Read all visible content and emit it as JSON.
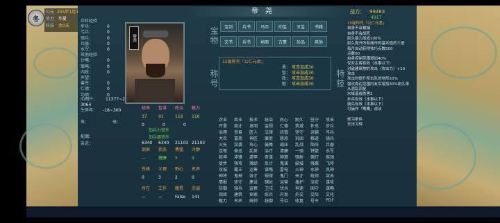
{
  "header": {
    "era_label": "公元",
    "date": "255年1月1",
    "faction_label": "势力",
    "faction_value": "华夏",
    "tech_label": "科技",
    "tech_value": "余0天",
    "season_char": "冬",
    "title": "帝　尧",
    "power_label": "战力：",
    "power_value": "99483",
    "power_sub": "4917"
  },
  "left_stats": [
    {
      "label": "兵科经验",
      "value": ""
    },
    {
      "label": "步兵：",
      "value": "0"
    },
    {
      "label": "弓兵：",
      "value": "0"
    },
    {
      "label": "骑兵：",
      "value": "0"
    },
    {
      "label": "兵器：",
      "value": "0"
    },
    {
      "label": "水军：",
      "value": "0"
    },
    {
      "label": "其他经验",
      "value": ""
    },
    {
      "label": "计略：",
      "value": "0"
    },
    {
      "label": "策略：",
      "value": "0"
    },
    {
      "label": "内政：",
      "value": "0"
    },
    {
      "label": "声望：",
      "value": ""
    },
    {
      "label": "兽性：",
      "value": "0"
    },
    {
      "label": "仁德：",
      "value": "0"
    },
    {
      "label": "功绩：",
      "value": "0"
    }
  ],
  "portrait_name": "帝尧",
  "id_label": "ID图片：",
  "id_value": "11377~2",
  "id_num": "3064",
  "birth_label": "生卒年：",
  "birth_value": "-18~300",
  "lifespan_label": "寿：",
  "mother_label": "母：",
  "spouse_label": "配偶：",
  "child_label": "亲近：",
  "ability_headers": [
    "统率",
    "智谋",
    "政治",
    "魅力"
  ],
  "ability_values": [
    "37",
    "91",
    "116",
    "116"
  ],
  "attrs_row2": [
    "0",
    "0",
    "0"
  ],
  "bonus1": "加兵力锁外",
  "bonus2": "加兵器锁外",
  "nums_row": [
    "6340",
    "6340",
    "21103",
    "21103"
  ],
  "status_headers": [
    "部屏",
    "状态",
    "勇猛",
    "冷静"
  ],
  "status_values": [
    "—",
    "健康",
    "5",
    "9"
  ],
  "traits_headers": [
    "性格",
    "义理",
    "野心",
    "名声"
  ],
  "traits_values": [
    "0",
    "3",
    "2",
    "0"
  ],
  "work_headers": [
    "所在",
    "工作",
    "籍贯",
    "忠诚"
  ],
  "work_values": [
    "—",
    "—",
    "False",
    "141"
  ],
  "sections": {
    "treasure": "宝物",
    "title": "称号",
    "special": "特技"
  },
  "treasure_slots": [
    "宝剑",
    "兵书",
    "马匹",
    "印玺",
    "玉玺",
    "书籍",
    "文书",
    "兵书",
    "地图",
    "古董",
    "珍品",
    "其他"
  ],
  "title_box_label": "15级称号「公仁元君」",
  "title_rows": [
    {
      "k": "勇：",
      "v": "攻击加成30"
    },
    {
      "k": "智：",
      "v": "攻击加成30"
    },
    {
      "k": "政：",
      "v": "攻击加成30"
    },
    {
      "k": "魅：",
      "v": "攻击加成30"
    }
  ],
  "skill_grid": [
    [
      "农业",
      "商业",
      "技术",
      "统治",
      "民心",
      "耐久",
      "驻守",
      "攻击"
    ],
    [
      "开垦",
      "商才",
      "发明",
      "监视",
      "仁德",
      "筑城",
      "补充",
      "步兵"
    ],
    [
      "治理",
      "贸易",
      "匠人",
      "法律",
      "抚恤",
      "坚守",
      "运输",
      "弓兵"
    ],
    [
      "大农",
      "富商",
      "神匠",
      "廉吏",
      "慈悲",
      "巩固",
      "粮道",
      "骑兵"
    ],
    [
      "火矢",
      "突袭",
      "攻心",
      "鼓舞",
      "威压",
      "乱战",
      "陷阵",
      "兵器"
    ],
    [
      "连弩",
      "奋迅",
      "乱射",
      "治疗",
      "清廉",
      "一骑",
      "铁壁",
      "水军"
    ],
    [
      "乾坤",
      "冲锋",
      "遁甲",
      "奇谋",
      "神算",
      "骑射",
      "强行",
      "疾驰"
    ],
    [
      "徒步",
      "强攻",
      "激励",
      "反计",
      "鬼谋",
      "破城",
      "强袭",
      "飞将"
    ],
    [
      "攻城",
      "霸王",
      "运筹",
      "谋略",
      "雷电",
      "火神",
      "水神",
      "风神"
    ],
    [
      "神将",
      "鬼神",
      "奇才",
      "规律",
      "鬼门",
      "天才",
      "统领",
      "突击"
    ],
    [
      "情报",
      "坚守",
      "建设",
      "辅佐",
      "运营",
      "援护",
      "治安",
      "谋攻"
    ],
    [
      "防御",
      "骑兵",
      "监察",
      "卫戍",
      "伏兵",
      "神速",
      "固守",
      "谋略"
    ],
    [
      "指挥",
      "建筑",
      "探索",
      "练兵",
      "开发",
      "外交",
      "交际",
      "文化"
    ],
    [
      "魅力",
      "名声",
      "统帅",
      "统御",
      "号召",
      "收复",
      "号令",
      "PDF"
    ]
  ],
  "right_texts": [
    {
      "text": "15级称号「公仁元君」",
      "color": "orange"
    },
    {
      "text": "自身不会被捕",
      "color": "white"
    },
    {
      "text": "自身不会战死",
      "color": "white"
    },
    {
      "text": "耐久能力加成100%",
      "color": "white"
    },
    {
      "text": "耐久提升所有城市的基本值的三倍",
      "color": "white"
    },
    {
      "text": "每月自动获得技巧点数500",
      "color": "white"
    },
    {
      "text": "点数00",
      "color": "white"
    },
    {
      "text": "自身控制范围增加40%",
      "color": "white"
    },
    {
      "text": "仅对主将有效（本事以下）",
      "color": "white"
    },
    {
      "text": "对敌建筑物的攻击（攻击力）+10",
      "color": "white"
    },
    {
      "text": "攻击",
      "color": "white"
    },
    {
      "text": "攻击时提升所击队的地形10%",
      "color": "white"
    },
    {
      "text": "强攻周边范围内友军增加30%耐久率",
      "color": "white"
    },
    {
      "text": "从混乱回复",
      "color": "white"
    },
    {
      "text": "水域造成伤害2",
      "color": "white"
    },
    {
      "text": "步兵有效（本事以下）",
      "color": "white"
    },
    {
      "text": "骑兵有效（本事以下）",
      "color": "white"
    },
    {
      "text": "可操作「骞鹰」战法",
      "color": "white"
    },
    {
      "text": "",
      "color": "white"
    },
    {
      "text": "修习条件",
      "color": "white"
    },
    {
      "text": "无法习得",
      "color": "white"
    }
  ],
  "colors": {
    "panel": "#1f3a47",
    "accent": "#e8c34a",
    "text": "#cfe3ea"
  }
}
